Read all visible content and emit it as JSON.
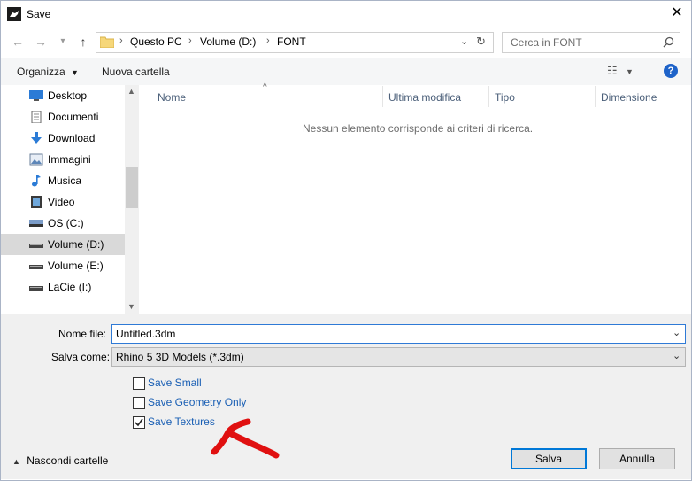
{
  "window": {
    "title": "Save"
  },
  "address_bar": {
    "segments": [
      "Questo PC",
      "Volume (D:)",
      "FONT"
    ]
  },
  "search": {
    "placeholder": "Cerca in FONT"
  },
  "toolbar": {
    "organize_label": "Organizza",
    "new_folder_label": "Nuova cartella",
    "help_label": "?"
  },
  "nav_pane": {
    "items": [
      {
        "label": "Desktop",
        "icon": "desktop-icon"
      },
      {
        "label": "Documenti",
        "icon": "documents-icon"
      },
      {
        "label": "Download",
        "icon": "download-icon"
      },
      {
        "label": "Immagini",
        "icon": "pictures-icon"
      },
      {
        "label": "Musica",
        "icon": "music-icon"
      },
      {
        "label": "Video",
        "icon": "video-icon"
      },
      {
        "label": "OS (C:)",
        "icon": "drive-icon"
      },
      {
        "label": "Volume (D:)",
        "icon": "drive-icon",
        "selected": true
      },
      {
        "label": "Volume (E:)",
        "icon": "drive-icon"
      },
      {
        "label": "LaCie (I:)",
        "icon": "drive-icon"
      }
    ]
  },
  "columns": [
    "Nome",
    "Ultima modifica",
    "Tipo",
    "Dimensione"
  ],
  "empty_message": "Nessun elemento corrisponde ai criteri di ricerca.",
  "form": {
    "filename_label": "Nome file:",
    "filename_value": "Untitled.3dm",
    "savetype_label": "Salva come:",
    "savetype_value": "Rhino 5 3D Models (*.3dm)"
  },
  "options": [
    {
      "label": "Save Small",
      "checked": false
    },
    {
      "label": "Save Geometry Only",
      "checked": false
    },
    {
      "label": "Save Textures",
      "checked": true
    }
  ],
  "footer": {
    "hide_folders_label": "Nascondi cartelle",
    "save_label": "Salva",
    "cancel_label": "Annulla"
  },
  "colors": {
    "accent": "#0078d7",
    "annotation": "#e01010"
  }
}
